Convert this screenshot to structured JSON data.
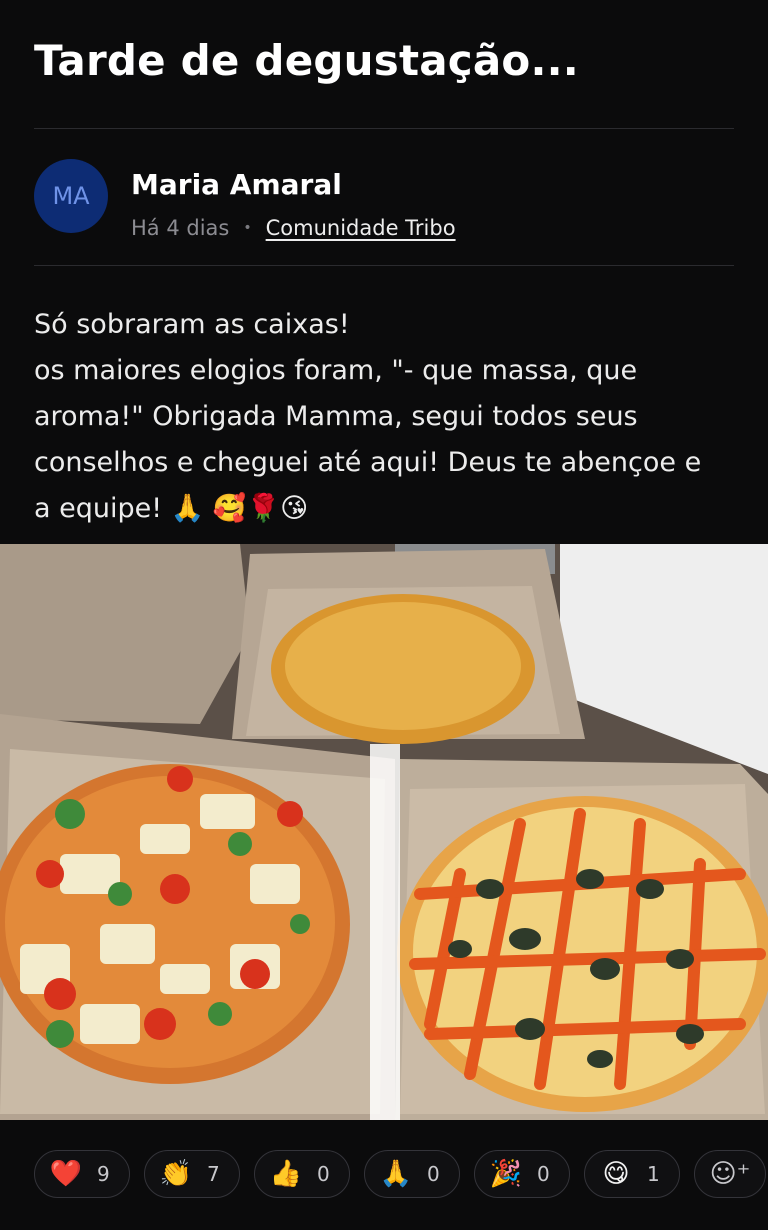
{
  "post": {
    "title": "Tarde de degustação...",
    "author": {
      "initials": "MA",
      "name": "Maria Amaral",
      "time": "Há 4 dias",
      "community": "Comunidade Tribo"
    },
    "body_lines": [
      "Só sobraram as caixas!",
      "os maiores elogios foram, \"- que massa, que",
      "aroma!\" Obrigada Mamma, segui todos seus",
      "conselhos e cheguei até aqui! Deus te abençoe e",
      "a equipe! 🙏 🥰🌹😘"
    ],
    "photo_icon": "photo-of-three-pizzas-in-boxes"
  },
  "reactions": [
    {
      "emoji": "❤️",
      "count": "9",
      "icon": "heart-icon"
    },
    {
      "emoji": "👏",
      "count": "7",
      "icon": "clap-icon"
    },
    {
      "emoji": "👍",
      "count": "0",
      "icon": "thumbs-up-icon"
    },
    {
      "emoji": "🙏",
      "count": "0",
      "icon": "pray-icon"
    },
    {
      "emoji": "🎉",
      "count": "0",
      "icon": "party-icon"
    },
    {
      "emoji": "😋",
      "count": "1",
      "icon": "yum-icon"
    }
  ],
  "add_reaction_icon": "add-reaction-icon",
  "colors": {
    "background": "#0b0b0c",
    "avatar_bg": "#0d2c74",
    "avatar_text": "#6f93e8"
  }
}
